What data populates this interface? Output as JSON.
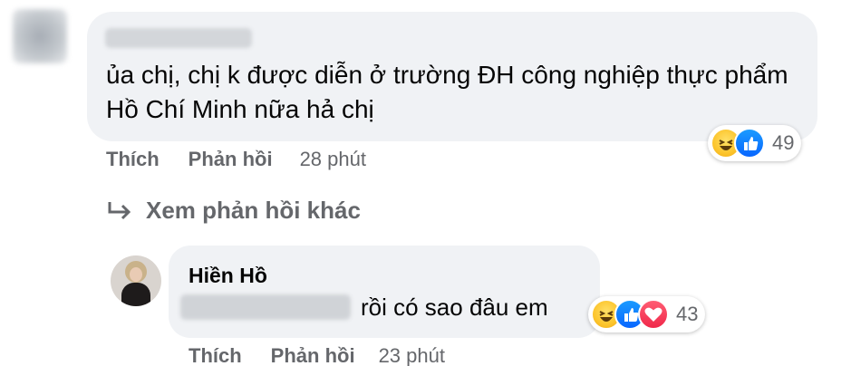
{
  "comment": {
    "text": "ủa chị, chị k được diễn ở trường ĐH công nghiệp thực phẩm Hồ Chí Minh nữa hả chị",
    "actions": {
      "like": "Thích",
      "reply": "Phản hồi",
      "time": "28 phút"
    },
    "reactions": {
      "icons": [
        "haha-icon",
        "like-icon"
      ],
      "count": "49"
    }
  },
  "more_replies": {
    "label": "Xem phản hồi khác"
  },
  "reply": {
    "author": "Hiền Hồ",
    "text": "rồi có sao đâu em",
    "actions": {
      "like": "Thích",
      "reply": "Phản hồi",
      "time": "23 phút"
    },
    "reactions": {
      "icons": [
        "haha-icon",
        "like-icon",
        "love-icon"
      ],
      "count": "43"
    }
  },
  "colors": {
    "bubble": "#f0f2f5",
    "text": "#050505",
    "secondary_text": "#65676b",
    "like": "#0866ff",
    "love": "#f0284a",
    "haha": "#fcc52d"
  }
}
